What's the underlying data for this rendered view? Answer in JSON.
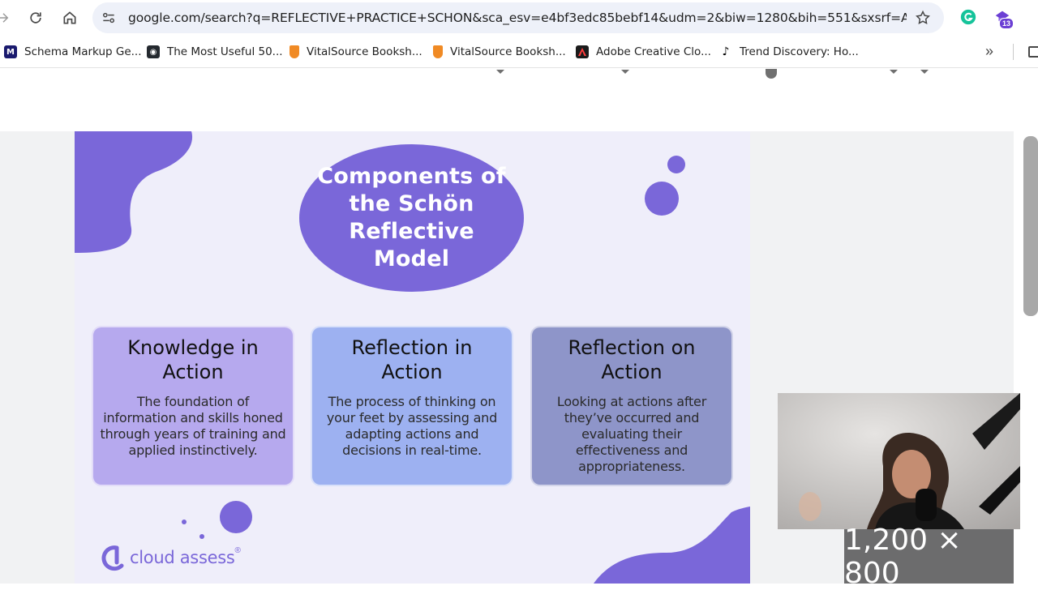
{
  "browser": {
    "url": "google.com/search?q=REFLECTIVE+PRACTICE+SCHON&sca_esv=e4bf3edc85bebf14&udm=2&biw=1280&bih=551&sxsrf=AE3TifPF...",
    "extension_badge": "13",
    "bookmarks": [
      {
        "label": "Schema Markup Ge...",
        "icon": "schema-markup-favicon",
        "color": "#1a1a6e"
      },
      {
        "label": "The Most Useful 50...",
        "icon": "github-favicon",
        "color": "#24292f"
      },
      {
        "label": "VitalSource Booksh...",
        "icon": "vitalsource-favicon",
        "color": "#f08a24"
      },
      {
        "label": "VitalSource Booksh...",
        "icon": "vitalsource-favicon",
        "color": "#f08a24"
      },
      {
        "label": "Adobe Creative Clo...",
        "icon": "adobe-favicon",
        "color": "#1b1b1b"
      },
      {
        "label": "Trend Discovery: Ho...",
        "icon": "tiktok-favicon",
        "color": "#000000"
      }
    ]
  },
  "image": {
    "title": "Components of the Schön Reflective Model",
    "cards": [
      {
        "title": "Knowledge in Action",
        "body": "The foundation of information and skills honed through years of training and applied instinctively."
      },
      {
        "title": "Reflection in Action",
        "body": "The process of thinking on your feet by assessing and adapting actions and decisions in real-time."
      },
      {
        "title": "Reflection on Action",
        "body": "Looking at actions after they’ve occurred and evaluating their effectiveness and appropriateness."
      }
    ],
    "logo": "cloud assess",
    "logo_mark": "®",
    "accent_color": "#7a67d9"
  },
  "dimensions_label": "1,200 × 800"
}
